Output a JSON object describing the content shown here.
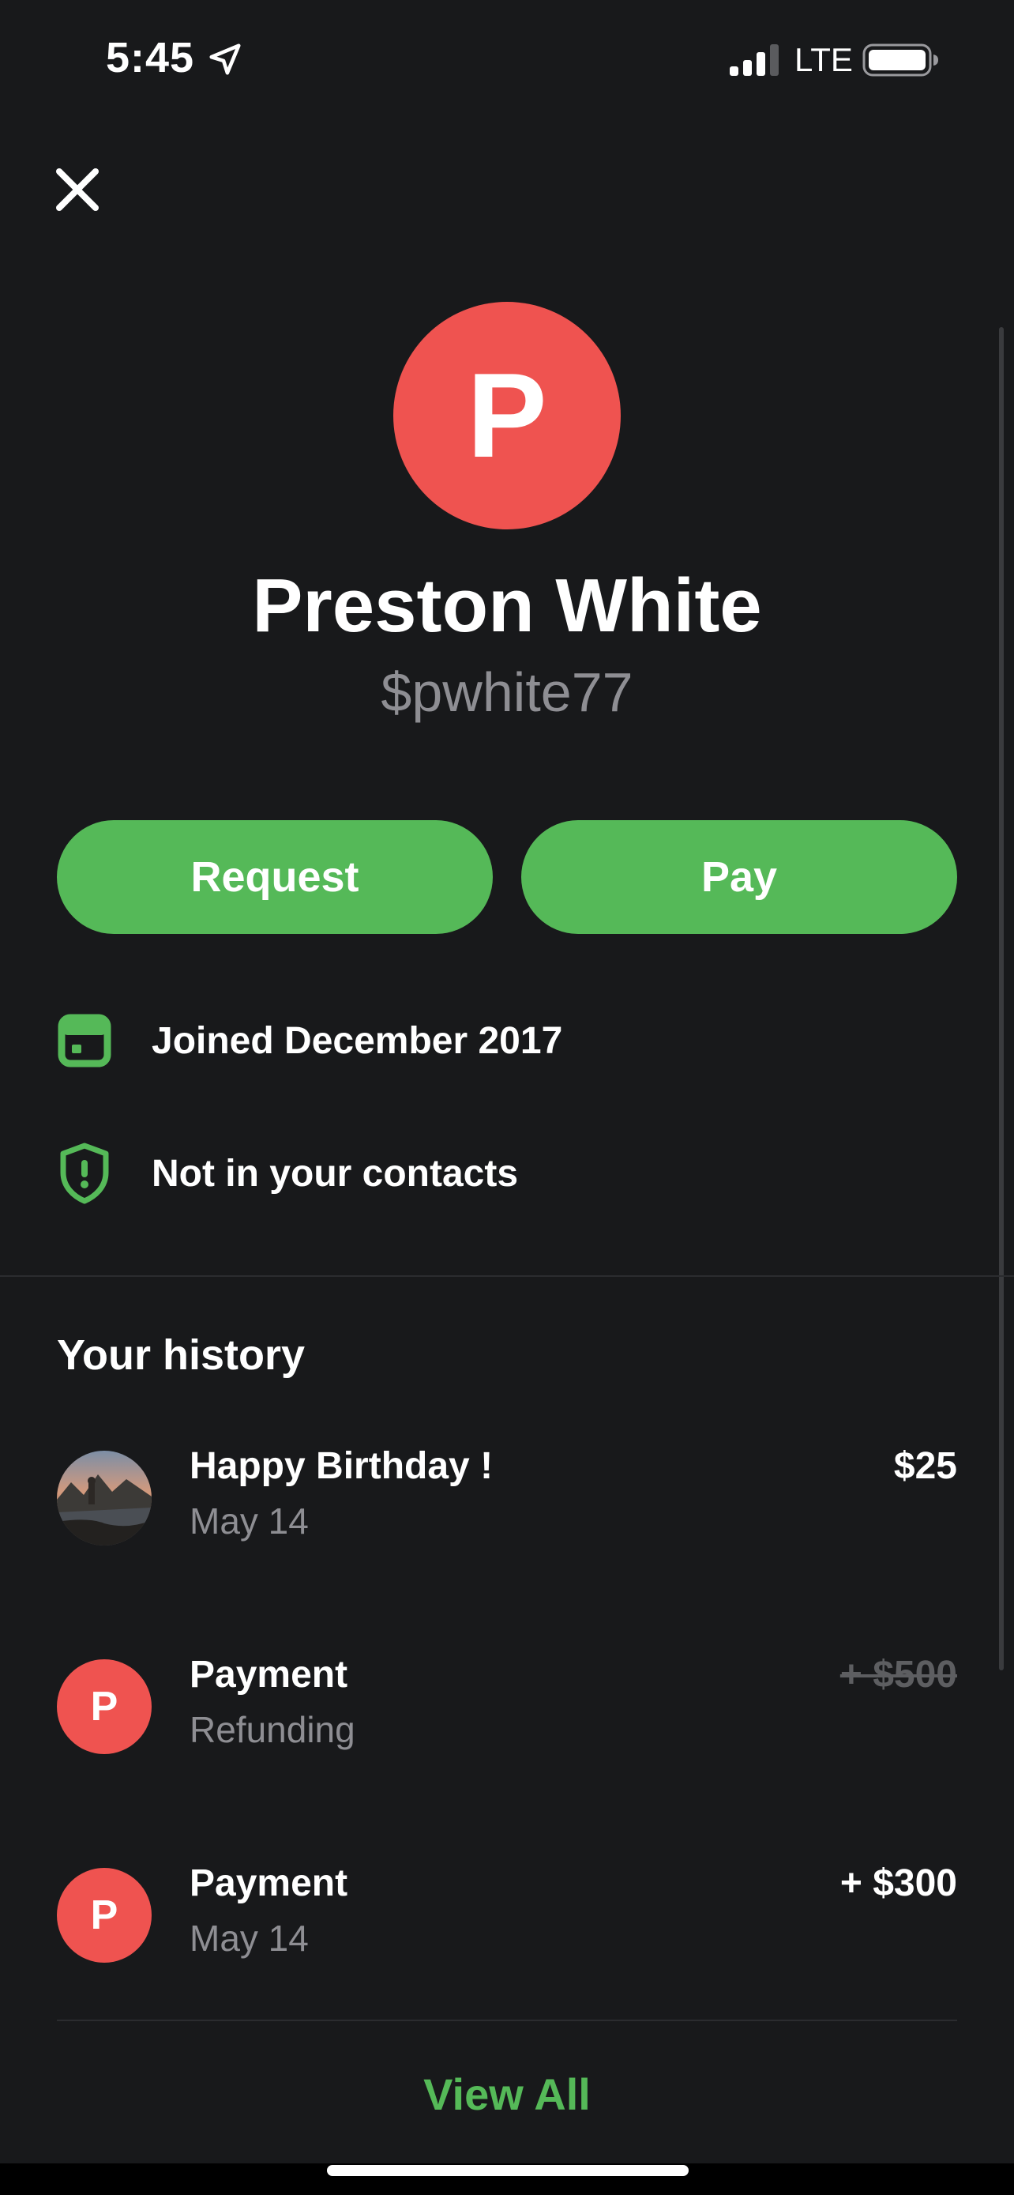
{
  "status_bar": {
    "time": "5:45",
    "network": "LTE",
    "icons": [
      "location-arrow-icon",
      "cellular-signal-icon",
      "battery-icon"
    ]
  },
  "header": {
    "close_icon": "close-icon"
  },
  "profile": {
    "avatar_initial": "P",
    "avatar_color": "#ef5350",
    "name": "Preston White",
    "handle": "$pwhite77"
  },
  "actions": {
    "request_label": "Request",
    "pay_label": "Pay",
    "button_color": "#55b958"
  },
  "info": [
    {
      "icon": "calendar-icon",
      "label": "Joined December 2017"
    },
    {
      "icon": "shield-alert-icon",
      "label": "Not in your contacts"
    }
  ],
  "history": {
    "title": "Your history",
    "items": [
      {
        "avatar": "photo",
        "title": "Happy Birthday !",
        "subtitle": "May 14",
        "amount": "$25",
        "struck": false
      },
      {
        "avatar": "P",
        "title": "Payment",
        "subtitle": "Refunding",
        "amount": "+ $500",
        "struck": true
      },
      {
        "avatar": "P",
        "title": "Payment",
        "subtitle": "May 14",
        "amount": "+ $300",
        "struck": false
      }
    ],
    "view_all_label": "View All"
  },
  "colors": {
    "background": "#18191b",
    "accent": "#55b958",
    "secondary_text": "#8e8e93"
  }
}
